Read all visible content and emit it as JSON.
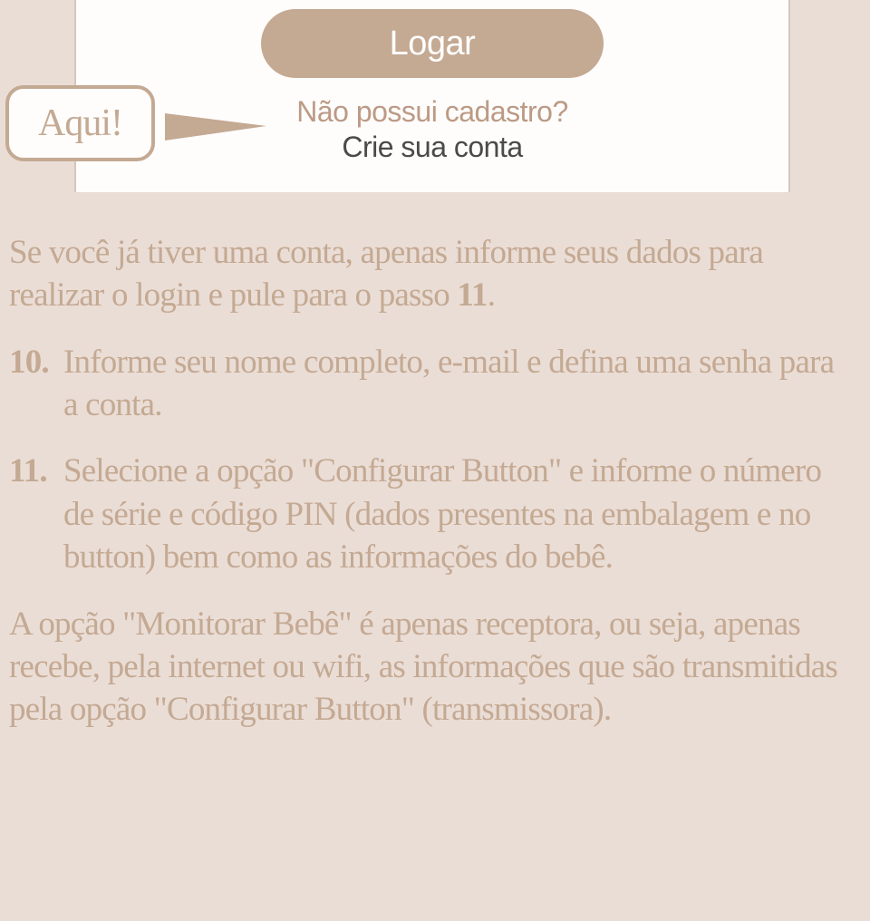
{
  "screenshot": {
    "login_button": "Logar",
    "register_question": "Não possui cadastro?",
    "register_link": "Crie sua conta"
  },
  "callout": {
    "label": "Aqui!"
  },
  "intro": {
    "text_part1": "Se você já tiver uma conta, apenas informe seus dados para realizar o login e pule para o passo ",
    "step_ref": "11",
    "text_part2": "."
  },
  "steps": [
    {
      "number": "10.",
      "text": "Informe seu nome completo, e-mail e defina uma senha para a conta."
    },
    {
      "number": "11.",
      "text": "Selecione a opção \"Configurar Button\" e informe o número de série e código PIN (dados presentes na embalagem e no button) bem como  as informações do bebê."
    }
  ],
  "note": "A opção \"Monitorar Bebê\" é apenas receptora, ou seja, apenas recebe, pela internet ou wifi, as informações que são transmitidas pela opção \"Configurar Button\" (transmissora)."
}
